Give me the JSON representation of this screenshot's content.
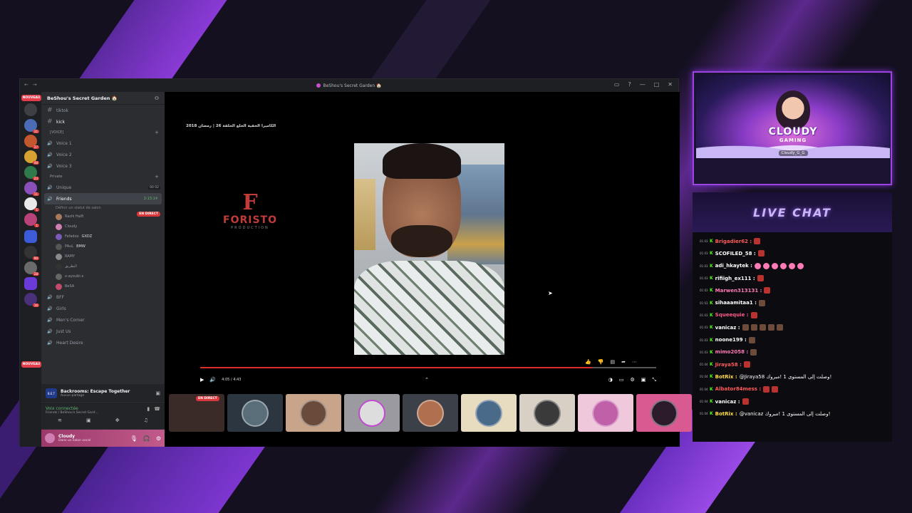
{
  "window": {
    "title": "BeShou's Secret Garden 🏠",
    "controls": [
      "▭",
      "?",
      "—",
      "□",
      "✕"
    ]
  },
  "servers": {
    "nouveau_top": "NOUVEAU",
    "nouveau_bottom": "NOUVEAU",
    "badges": [
      "31",
      "27",
      "48",
      "23",
      "11",
      "1",
      "1",
      "90",
      "28",
      "16"
    ]
  },
  "sidebar": {
    "server_name": "BeShou's Secret Garden 🏠",
    "text_channels": [
      {
        "name": "tiktok"
      },
      {
        "name": "kick"
      }
    ],
    "voice_category": "[VOICE]",
    "voice_channels": [
      "Voice 1",
      "Voice 2",
      "Voice 3"
    ],
    "private_category": "Private",
    "unique_channel": "Unique",
    "unique_count": "00 02",
    "friends_channel": "Friends",
    "friends_timer": "2:13:14",
    "friends_status": "Définir un statut de salon",
    "live_tag": "EN DIRECT",
    "members": [
      "Razik Haifi",
      "Cloudy",
      "Fafadoo",
      "PAuL",
      "RAMY",
      "البطريق",
      "x-ayoubi-x",
      "BeSA"
    ],
    "member_tags": {
      "fafadoo": "GXDZ",
      "paul": "BMW"
    },
    "more_channels": [
      "BFF",
      "Girls",
      "Men's Corner",
      "Just Us",
      "Heart Desire"
    ]
  },
  "activity": {
    "title": "Backrooms: Escape Together",
    "subtitle": "Aucun partage",
    "icon_text": "B.E.T"
  },
  "voice": {
    "status": "Voix connectée",
    "location": "Friends / BeShou's Secret Gard..."
  },
  "user": {
    "name": "Cloudy",
    "status": "Dans un salon vocal"
  },
  "stream": {
    "video_title": "الكاميرا الخفية الخلع الحلقة 26 | رمضان 2018",
    "logo_mark": "F",
    "logo_name": "FORISTO",
    "logo_sub": "PRODUCTION",
    "time": "4:05 / 4:43",
    "progress": 0.86,
    "tile_live": "EN DIRECT"
  },
  "cam": {
    "brand": "CLOUDY",
    "brand_sub": "GAMING",
    "handle": "Cloudy_G_G"
  },
  "chat": {
    "title": "LIVE CHAT",
    "messages": [
      {
        "time": "01:03",
        "user": "Brigadier62",
        "color": "#ff5a5a",
        "text": "",
        "emotes": [
          "r"
        ]
      },
      {
        "time": "01:03",
        "user": "SCOFILED_58",
        "color": "#ffffff",
        "text": "",
        "emotes": [
          "r"
        ]
      },
      {
        "time": "01:03",
        "user": "adi_hkaytek",
        "color": "#ffffff",
        "text": "",
        "emotes": [
          "p",
          "p",
          "p",
          "p",
          "p",
          "p"
        ]
      },
      {
        "time": "01:03",
        "user": "rifiigh_ex111",
        "color": "#ffffff",
        "text": "",
        "emotes": [
          "r"
        ]
      },
      {
        "time": "01:03",
        "user": "Marwen313131",
        "color": "#ff7ab6",
        "text": "",
        "emotes": [
          "r"
        ]
      },
      {
        "time": "01:03",
        "user": "sihaaamitaa1",
        "color": "#ffffff",
        "text": "",
        "emotes": [
          "b"
        ]
      },
      {
        "time": "01:03",
        "user": "Squeequie",
        "color": "#ff5a8a",
        "text": "",
        "emotes": [
          "r"
        ]
      },
      {
        "time": "01:03",
        "user": "vanicaz",
        "color": "#ffffff",
        "text": "",
        "emotes": [
          "b",
          "b",
          "b",
          "b",
          "b"
        ]
      },
      {
        "time": "01:03",
        "user": "noone199",
        "color": "#ffffff",
        "text": "",
        "emotes": [
          "b"
        ]
      },
      {
        "time": "01:03",
        "user": "mimo2058",
        "color": "#ff7ab6",
        "text": "",
        "emotes": [
          "b"
        ]
      },
      {
        "time": "01:04",
        "user": "Jiraya58",
        "color": "#ff5a5a",
        "text": "",
        "emotes": [
          "r"
        ]
      },
      {
        "time": "01:04",
        "user": "BotRix",
        "color": "#ffdd44",
        "text": "@Jiraya58 وصلت إلى المستوى 1 !مبروك!",
        "emotes": []
      },
      {
        "time": "01:04",
        "user": "Albator84mess",
        "color": "#ff5a5a",
        "text": "",
        "emotes": [
          "r",
          "r"
        ]
      },
      {
        "time": "01:04",
        "user": "vanicaz",
        "color": "#ffffff",
        "text": "",
        "emotes": [
          "r"
        ]
      },
      {
        "time": "01:04",
        "user": "BotRix",
        "color": "#ffdd44",
        "text": "@vanicaz وصلت إلى المستوى 1 !مبروك!",
        "emotes": []
      }
    ]
  },
  "colors": {
    "accent": "#9a45e0",
    "live_red": "#da373c",
    "kick_green": "#53fc18"
  }
}
